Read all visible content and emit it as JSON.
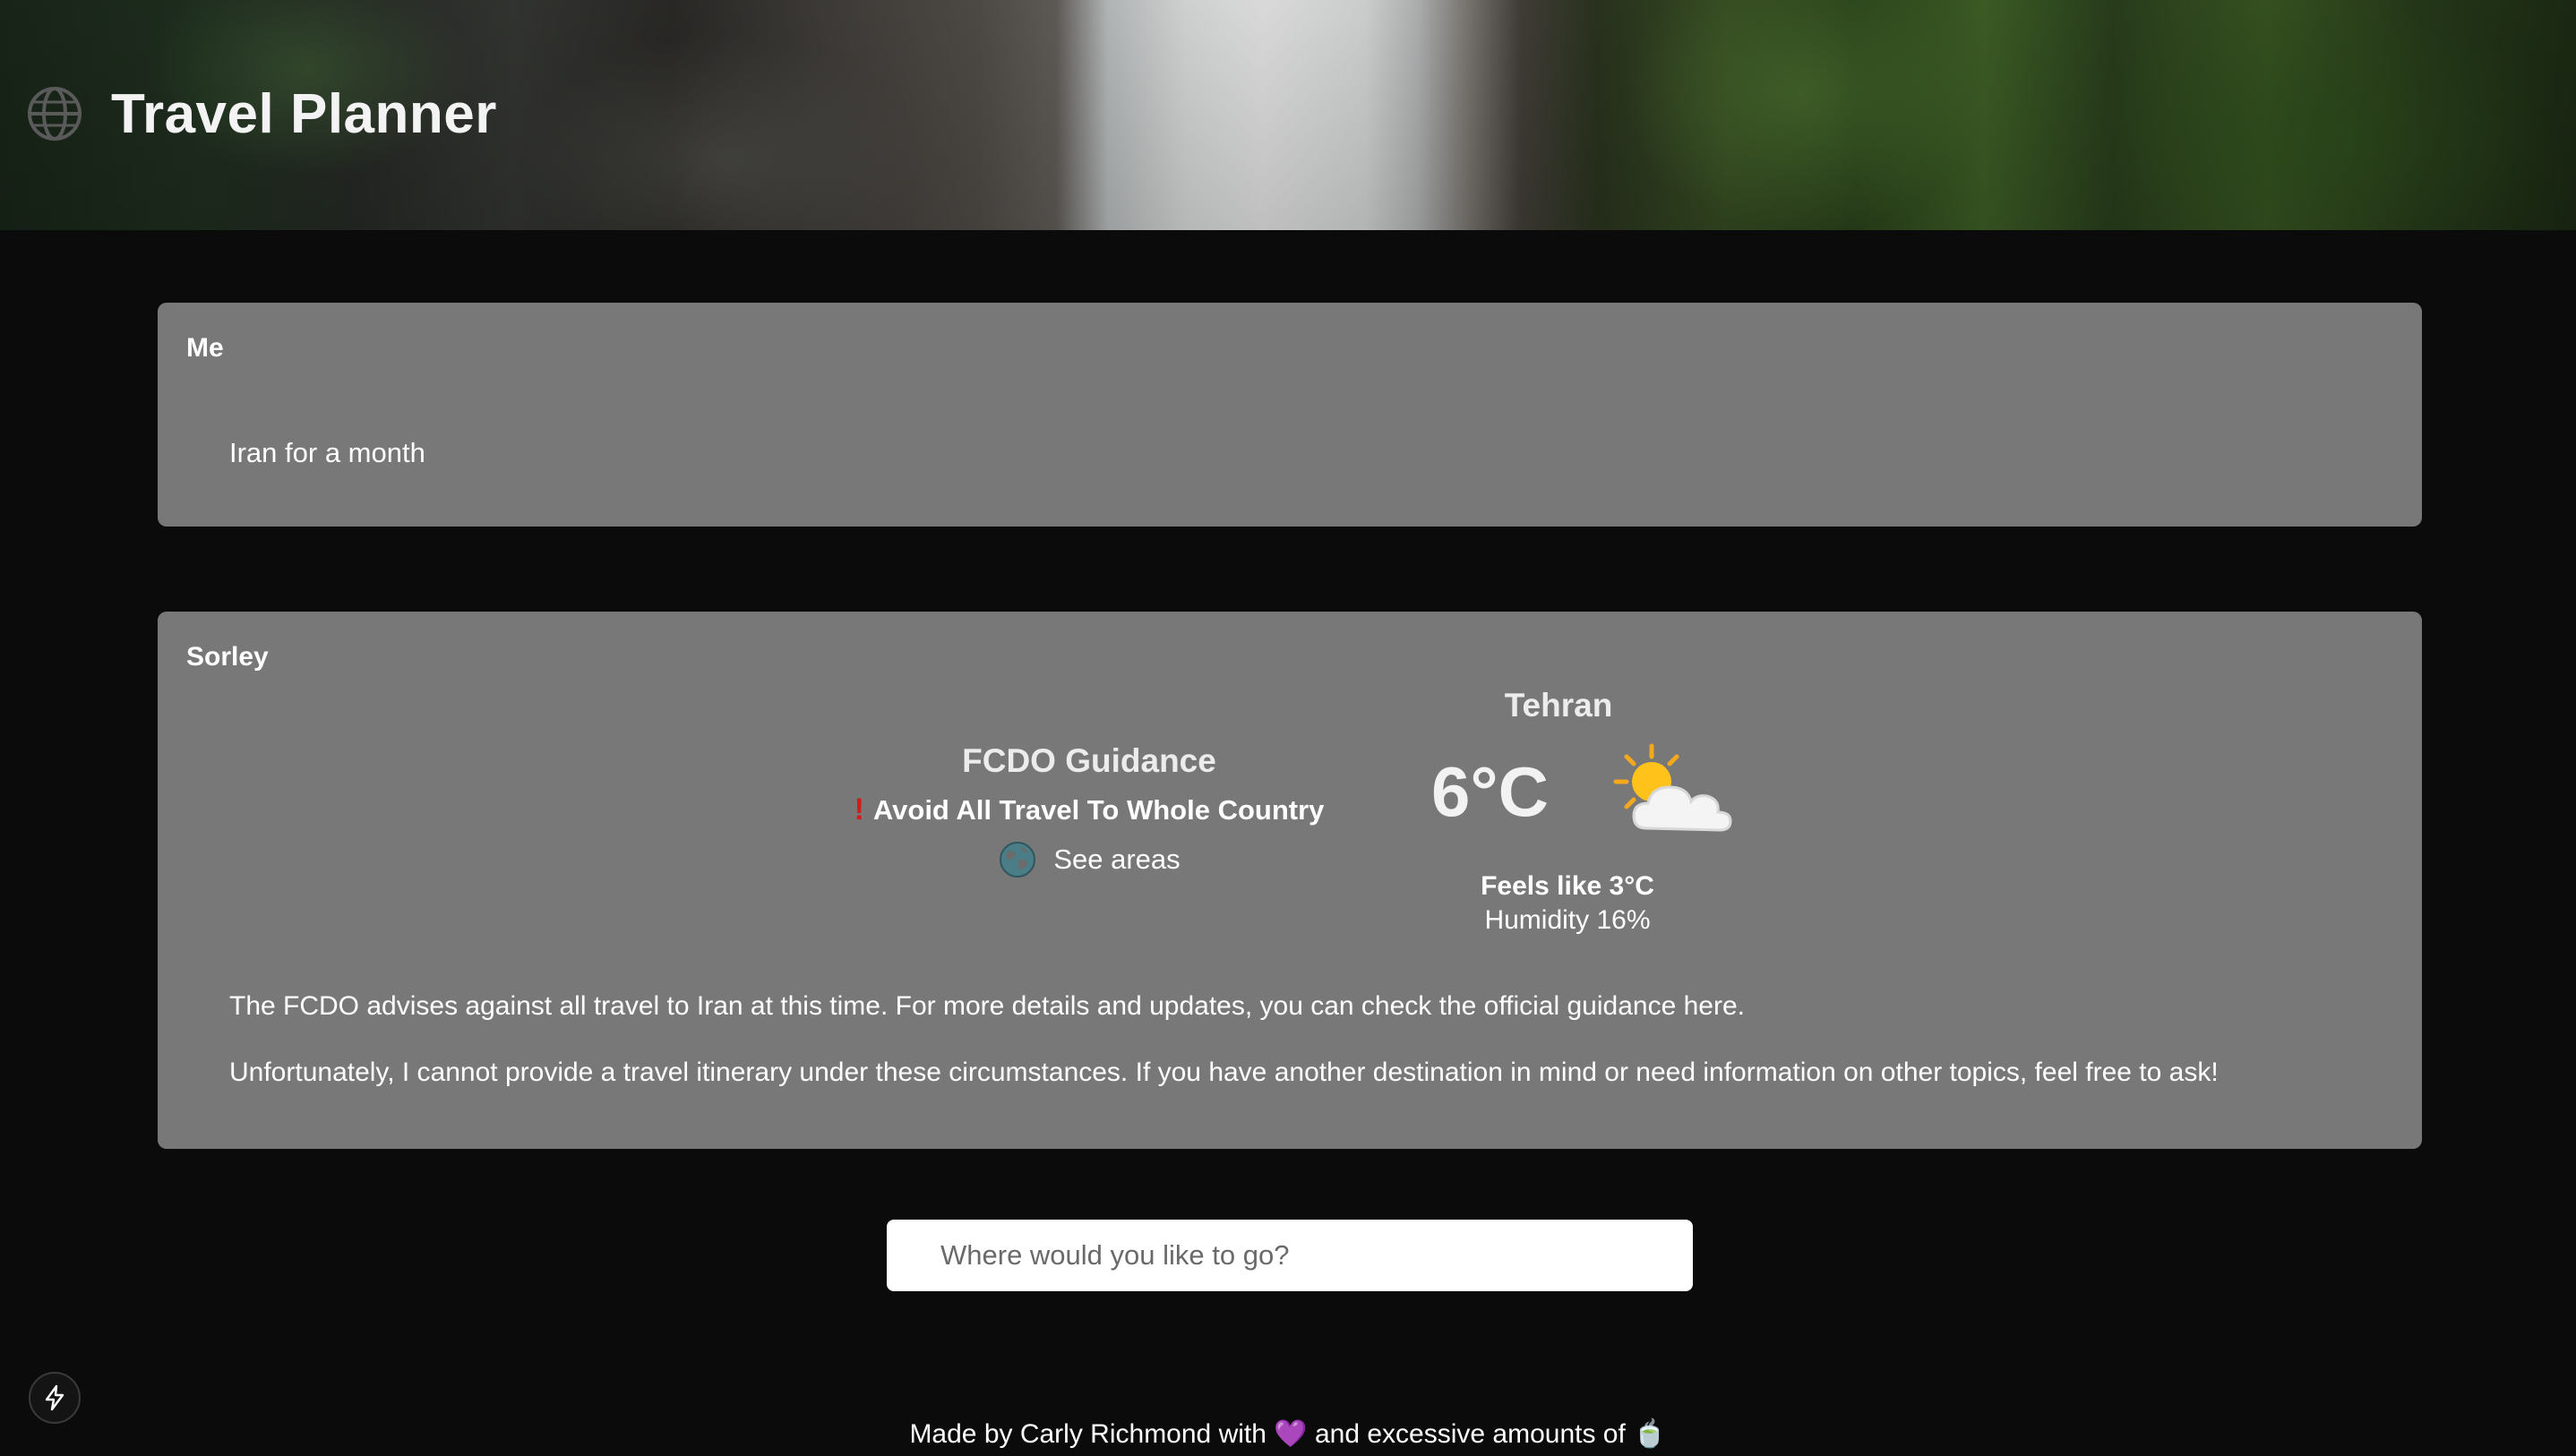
{
  "app": {
    "title": "Travel Planner",
    "logo_icon": "globe-icon"
  },
  "messages": [
    {
      "sender": "Me",
      "text": "Iran for a month"
    },
    {
      "sender": "Sorley",
      "fcdo": {
        "title": "FCDO Guidance",
        "warning_icon": "exclamation-icon",
        "warning": "Avoid All Travel To Whole Country",
        "areas_icon": "map-globe-icon",
        "areas_link": "See areas"
      },
      "weather": {
        "city": "Tehran",
        "temperature": "6°C",
        "icon": "sun-behind-cloud-icon",
        "feels_like": "Feels like 3°C",
        "humidity": "Humidity 16%"
      },
      "paragraphs": [
        "The FCDO advises against all travel to Iran at this time. For more details and updates, you can check the official guidance here.",
        "Unfortunately, I cannot provide a travel itinerary under these circumstances. If you have another destination in mind or need information on other topics, feel free to ask!"
      ]
    }
  ],
  "search": {
    "placeholder": "Where would you like to go?"
  },
  "footer": {
    "prefix": "Made by Carly Richmond with",
    "heart": "💜",
    "middle": "and excessive amounts of",
    "tea": "🍵"
  },
  "colors": {
    "background": "#0b0b0b",
    "card": "#787878",
    "warning": "#d21b1b"
  }
}
